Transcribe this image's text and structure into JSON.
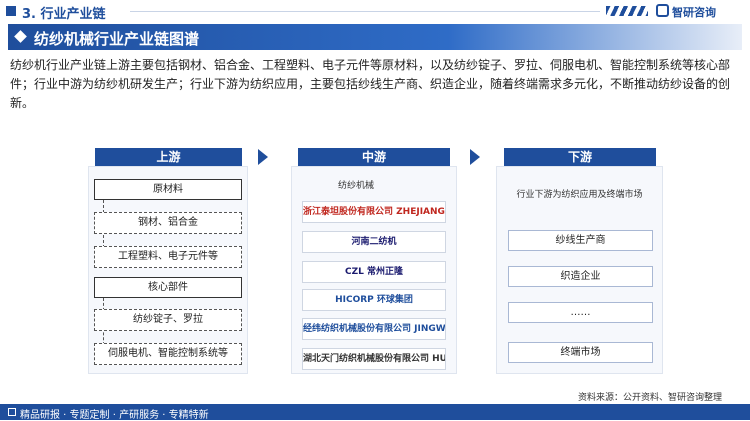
{
  "header": {
    "section_title": "3. 行业产业链",
    "brand_name": "智研咨询"
  },
  "banner": {
    "title": "纺纱机械行业产业链图谱"
  },
  "intro": "纺纱机行业产业链上游主要包括钢材、铝合金、工程塑料、电子元件等原材料，以及纺纱锭子、罗拉、伺服电机、智能控制系统等核心部件；行业中游为纺纱机研发生产；行业下游为纺织应用，主要包括纱线生产商、织造企业，随着终端需求多元化，不断推动纺纱设备的创新。",
  "upstream": {
    "label": "上游",
    "raw_title": "原材料",
    "raw_items": [
      "钢材、铝合金",
      "工程塑料、电子元件等"
    ],
    "core_title": "核心部件",
    "core_items": [
      "纺纱锭子、罗拉",
      "伺服电机、智能控制系统等"
    ]
  },
  "midstream": {
    "label": "中游",
    "subtitle": "纺纱机械",
    "companies": [
      "浙江泰坦股份有限公司 ZHEJIANG TAITAN CO., LTD.",
      "河南二纺机",
      "CZL 常州正隆",
      "HICORP 环球集团",
      "经纬纺织机械股份有限公司 JINGWEI TEXTILE MACHINERY CO., LTD",
      "湖北天门纺织机械股份有限公司 HUBEI TIANMEN TEXTILE MACHINERY CO., LTD"
    ]
  },
  "downstream": {
    "label": "下游",
    "subtitle": "行业下游为纺织应用及终端市场",
    "items": [
      "纱线生产商",
      "织造企业",
      "……",
      "终端市场"
    ]
  },
  "footer": {
    "left_text": "精品研报 · 专题定制 · 产研服务 · 专精特新",
    "source": "资料来源：公开资料、智研咨询整理"
  },
  "colors": {
    "primary": "#1f4e9c",
    "panel": "#f6f8fc"
  }
}
